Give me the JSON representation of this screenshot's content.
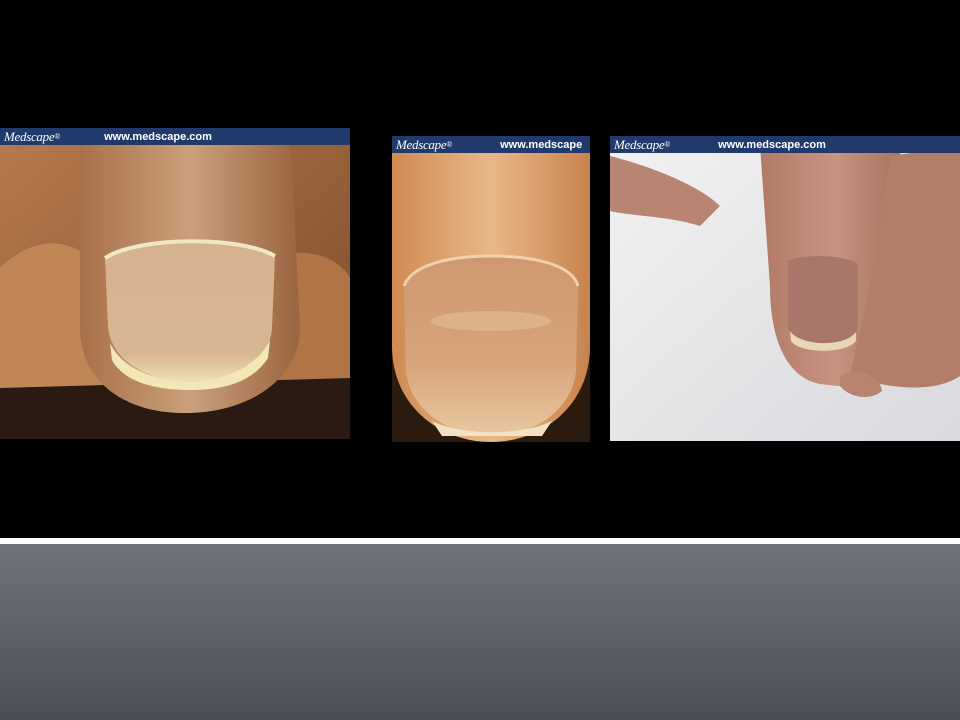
{
  "slide": {
    "images": [
      {
        "banner_logo": "Medscape",
        "banner_reg": "®",
        "banner_url": "www.medscape.com"
      },
      {
        "banner_logo": "Medscape",
        "banner_reg": "®",
        "banner_url": "www.medscape"
      },
      {
        "banner_logo": "Medscape",
        "banner_reg": "®",
        "banner_url": "www.medscape.com"
      }
    ]
  },
  "colors": {
    "background": "#000000",
    "divider": "#ffffff",
    "footer_gradient": [
      "#6e727a",
      "#4b4e56"
    ],
    "banner": "#1f3a6b"
  }
}
